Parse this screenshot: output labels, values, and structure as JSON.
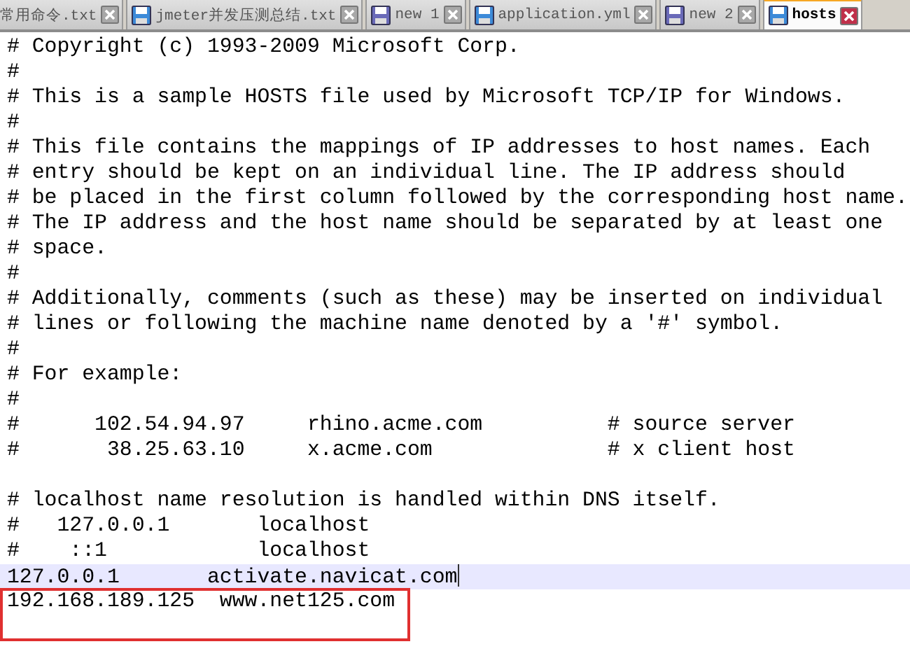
{
  "tabs": [
    {
      "label": "常用命令.txt",
      "selected": false
    },
    {
      "label": "jmeter并发压测总结.txt",
      "selected": false,
      "color": "#3c8ad8"
    },
    {
      "label": "new 1",
      "selected": false,
      "color": "#6a6ab8"
    },
    {
      "label": "application.yml",
      "selected": false,
      "color": "#3c8ad8"
    },
    {
      "label": "new 2",
      "selected": false,
      "color": "#6a6ab8"
    },
    {
      "label": "hosts",
      "selected": true,
      "color": "#3c8ad8"
    }
  ],
  "editor": {
    "lines": [
      {
        "text": "# Copyright (c) 1993-2009 Microsoft Corp.",
        "current": false
      },
      {
        "text": "#",
        "current": false
      },
      {
        "text": "# This is a sample HOSTS file used by Microsoft TCP/IP for Windows.",
        "current": false
      },
      {
        "text": "#",
        "current": false
      },
      {
        "text": "# This file contains the mappings of IP addresses to host names. Each",
        "current": false
      },
      {
        "text": "# entry should be kept on an individual line. The IP address should",
        "current": false
      },
      {
        "text": "# be placed in the first column followed by the corresponding host name.",
        "current": false
      },
      {
        "text": "# The IP address and the host name should be separated by at least one",
        "current": false
      },
      {
        "text": "# space.",
        "current": false
      },
      {
        "text": "#",
        "current": false
      },
      {
        "text": "# Additionally, comments (such as these) may be inserted on individual",
        "current": false
      },
      {
        "text": "# lines or following the machine name denoted by a '#' symbol.",
        "current": false
      },
      {
        "text": "#",
        "current": false
      },
      {
        "text": "# For example:",
        "current": false
      },
      {
        "text": "#",
        "current": false
      },
      {
        "text": "#      102.54.94.97     rhino.acme.com          # source server",
        "current": false
      },
      {
        "text": "#       38.25.63.10     x.acme.com              # x client host",
        "current": false
      },
      {
        "current": false
      },
      {
        "text": "# localhost name resolution is handled within DNS itself.",
        "current": false
      },
      {
        "text": "#   127.0.0.1       localhost",
        "current": false
      },
      {
        "text": "#    ::1            localhost",
        "current": false
      },
      {
        "text": "127.0.0.1       activate.navicat.com",
        "current": true
      },
      {
        "text": "192.168.189.125  www.net125.com",
        "current": false,
        "framed": true
      }
    ]
  }
}
